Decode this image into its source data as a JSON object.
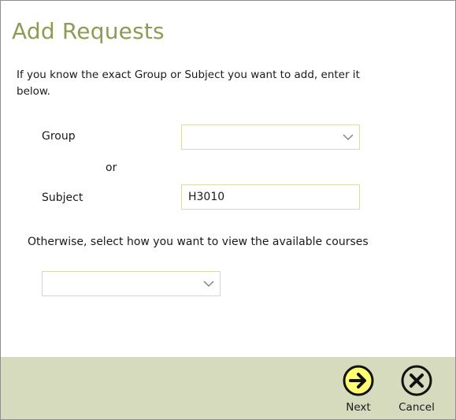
{
  "header": {
    "title": "Add Requests"
  },
  "intro": {
    "text": "If you know the exact Group or Subject you want to add, enter it below."
  },
  "form": {
    "group_label": "Group",
    "or_label": "or",
    "subject_label": "Subject",
    "subject_value": "H3010",
    "group_selected": "",
    "otherwise_text": "Otherwise, select how you want to view the available courses",
    "view_selected": ""
  },
  "footer": {
    "next_label": "Next",
    "cancel_label": "Cancel"
  },
  "colors": {
    "accent": "#8f9a55",
    "footer_bg": "#d7dbbd",
    "next_fill": "#ffff72",
    "field_border": "#dad9b0"
  },
  "icons": {
    "next": "arrow-right-circle-icon",
    "cancel": "close-circle-icon",
    "dropdown": "chevron-down-icon"
  }
}
